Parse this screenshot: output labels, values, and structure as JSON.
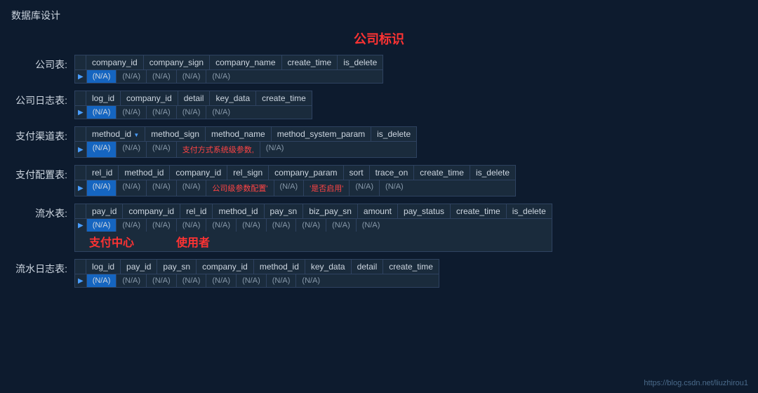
{
  "page": {
    "title": "数据库设计",
    "center_title": "公司标识",
    "watermark": "https://blog.csdn.net/liuzhirou1"
  },
  "tables": [
    {
      "label": "公司表:",
      "columns": [
        "company_id",
        "company_sign",
        "company_name",
        "create_time",
        "is_delete"
      ],
      "cells": [
        "(N/A)",
        "(N/A)",
        "(N/A)",
        "(N/A)",
        "(N/A)"
      ],
      "highlight_col": 0,
      "extra": null
    },
    {
      "label": "公司日志表:",
      "columns": [
        "log_id",
        "company_id",
        "detail",
        "key_data",
        "create_time"
      ],
      "cells": [
        "(N/A)",
        "(N/A)",
        "(N/A)",
        "(N/A)",
        "(N/A)"
      ],
      "highlight_col": 0,
      "extra": null
    },
    {
      "label": "支付渠道表:",
      "columns": [
        "method_id",
        "method_sign",
        "method_name",
        "method_system_param",
        "is_delete"
      ],
      "cells": [
        "(N/A)",
        "(N/A)",
        "(N/A)",
        "支付方式系统级参数,",
        "(N/A)"
      ],
      "highlight_col": 0,
      "dropdown_col": 0,
      "extra": null
    },
    {
      "label": "支付配置表:",
      "columns": [
        "rel_id",
        "method_id",
        "company_id",
        "rel_sign",
        "company_param",
        "sort",
        "trace_on",
        "create_time",
        "is_delete"
      ],
      "cells": [
        "(N/A)",
        "(N/A)",
        "(N/A)",
        "(N/A)",
        "公司级参数配置'",
        "(N/A)",
        "'是否启用'",
        "(N/A)",
        "(N/A)"
      ],
      "highlight_col": 0,
      "extra": null
    },
    {
      "label": "流水表:",
      "columns": [
        "pay_id",
        "company_id",
        "rel_id",
        "method_id",
        "pay_sn",
        "biz_pay_sn",
        "amount",
        "pay_status",
        "create_time",
        "is_delete"
      ],
      "cells": [
        "(N/A)",
        "(N/A)",
        "(N/A)",
        "(N/A)",
        "(N/A)",
        "(N/A)",
        "(N/A)",
        "(N/A)",
        "(N/A)",
        "(N/A)"
      ],
      "highlight_col": 0,
      "center_labels": [
        "支付中心",
        "使用者"
      ],
      "extra": null
    },
    {
      "label": "流水日志表:",
      "columns": [
        "log_id",
        "pay_id",
        "pay_sn",
        "company_id",
        "method_id",
        "key_data",
        "detail",
        "create_time"
      ],
      "cells": [
        "(N/A)",
        "(N/A)",
        "(N/A)",
        "(N/A)",
        "(N/A)",
        "(N/A)",
        "(N/A)",
        "(N/A)"
      ],
      "highlight_col": 0,
      "extra": null
    }
  ]
}
